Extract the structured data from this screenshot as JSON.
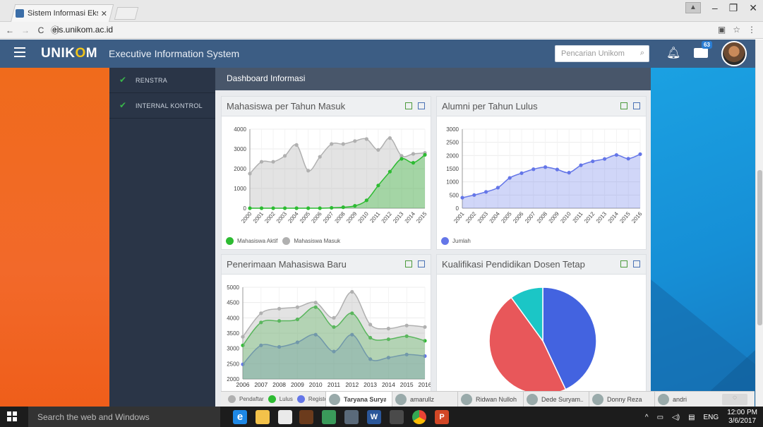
{
  "browser": {
    "tab_title": "Sistem Informasi Eksekut",
    "url": "eis.unikom.ac.id"
  },
  "header": {
    "brand_pre": "UNIK",
    "brand_o": "O",
    "brand_post": "M",
    "system_name": "Executive Information System",
    "search_placeholder": "Pencarian Unikom",
    "mail_badge": "63"
  },
  "sidebar": {
    "items": [
      {
        "label": "RENSTRA"
      },
      {
        "label": "INTERNAL KONTROL"
      }
    ]
  },
  "dashboard_title": "Dashboard Informasi",
  "panels": {
    "p1_title": "Mahasiswa per Tahun Masuk",
    "p2_title": "Alumni per Tahun Lulus",
    "p3_title": "Penerimaan Mahasiswa Baru",
    "p4_title": "Kualifikasi Pendidikan Dosen Tetap"
  },
  "chat_bar": {
    "users": [
      "Taryana Surya...",
      "amarullz",
      "Ridwan Nulloh",
      "Dede Suryam...",
      "Donny Reza",
      "andri"
    ]
  },
  "taskbar": {
    "search_text": "Search the web and Windows",
    "lang": "ENG",
    "time": "12:00 PM",
    "date": "3/6/2017"
  },
  "colors": {
    "header_bg": "#3c5d84",
    "sidebar_bg": "#2a3547",
    "orange": "#f06b1c",
    "blue": "#1ba1e2",
    "green": "#2dbb32",
    "gray": "#b0b0b0",
    "blue_series": "#6476e8",
    "red": "#e8575a",
    "teal": "#1bc6c6"
  },
  "chart_data": [
    {
      "type": "area",
      "title": "Mahasiswa per Tahun Masuk",
      "categories": [
        "2000",
        "2001",
        "2002",
        "2003",
        "2004",
        "2005",
        "2006",
        "2007",
        "2008",
        "2009",
        "2010",
        "2011",
        "2012",
        "2013",
        "2014",
        "2015"
      ],
      "ylim": [
        0,
        4000
      ],
      "yticks": [
        0,
        1000,
        2000,
        3000,
        4000
      ],
      "series": [
        {
          "name": "Mahasiswa Aktif",
          "color": "#2dbb32",
          "values": [
            0,
            0,
            0,
            0,
            0,
            0,
            0,
            20,
            50,
            120,
            400,
            1150,
            1850,
            2500,
            2300,
            2700
          ]
        },
        {
          "name": "Mahasiswa Masuk",
          "color": "#b0b0b0",
          "values": [
            1750,
            2350,
            2350,
            2650,
            3200,
            1900,
            2600,
            3250,
            3250,
            3400,
            3500,
            2950,
            3550,
            2650,
            2750,
            2800
          ]
        }
      ],
      "grid": true,
      "legend": "bottom-left"
    },
    {
      "type": "area",
      "title": "Alumni per Tahun Lulus",
      "categories": [
        "2001",
        "2002",
        "2003",
        "2004",
        "2005",
        "2006",
        "2007",
        "2008",
        "2009",
        "2010",
        "2011",
        "2012",
        "2013",
        "2014",
        "2015",
        "2016"
      ],
      "ylim": [
        0,
        3000
      ],
      "yticks": [
        0,
        500,
        1000,
        1500,
        2000,
        2500,
        3000
      ],
      "series": [
        {
          "name": "Jumlah",
          "color": "#6476e8",
          "values": [
            400,
            500,
            620,
            780,
            1150,
            1330,
            1480,
            1560,
            1470,
            1350,
            1630,
            1780,
            1870,
            2020,
            1880,
            2050
          ]
        }
      ],
      "grid": true,
      "legend": "bottom-left"
    },
    {
      "type": "area",
      "title": "Penerimaan Mahasiswa Baru",
      "categories": [
        "2006",
        "2007",
        "2008",
        "2009",
        "2010",
        "2011",
        "2012",
        "2013",
        "2014",
        "2015",
        "2016"
      ],
      "ylim": [
        2000,
        5000
      ],
      "yticks": [
        2000,
        2500,
        3000,
        3500,
        4000,
        4500,
        5000
      ],
      "series": [
        {
          "name": "Pendaftar",
          "color": "#b0b0b0",
          "values": [
            3380,
            4150,
            4300,
            4350,
            4500,
            4000,
            4850,
            3780,
            3650,
            3750,
            3700
          ]
        },
        {
          "name": "Lulus",
          "color": "#2dbb32",
          "values": [
            3100,
            3850,
            3900,
            3950,
            4350,
            3700,
            4150,
            3350,
            3300,
            3400,
            3250
          ]
        },
        {
          "name": "Register",
          "color": "#6476e8",
          "values": [
            2480,
            3100,
            3050,
            3200,
            3450,
            2900,
            3450,
            2650,
            2700,
            2800,
            2750
          ]
        }
      ],
      "grid": true,
      "legend": "bottom-left"
    },
    {
      "type": "pie",
      "title": "Kualifikasi Pendidikan Dosen Tetap",
      "series": [
        {
          "color": "#4363e0",
          "value": 43
        },
        {
          "color": "#e8575a",
          "value": 47
        },
        {
          "color": "#1bc6c6",
          "value": 10
        }
      ]
    }
  ]
}
